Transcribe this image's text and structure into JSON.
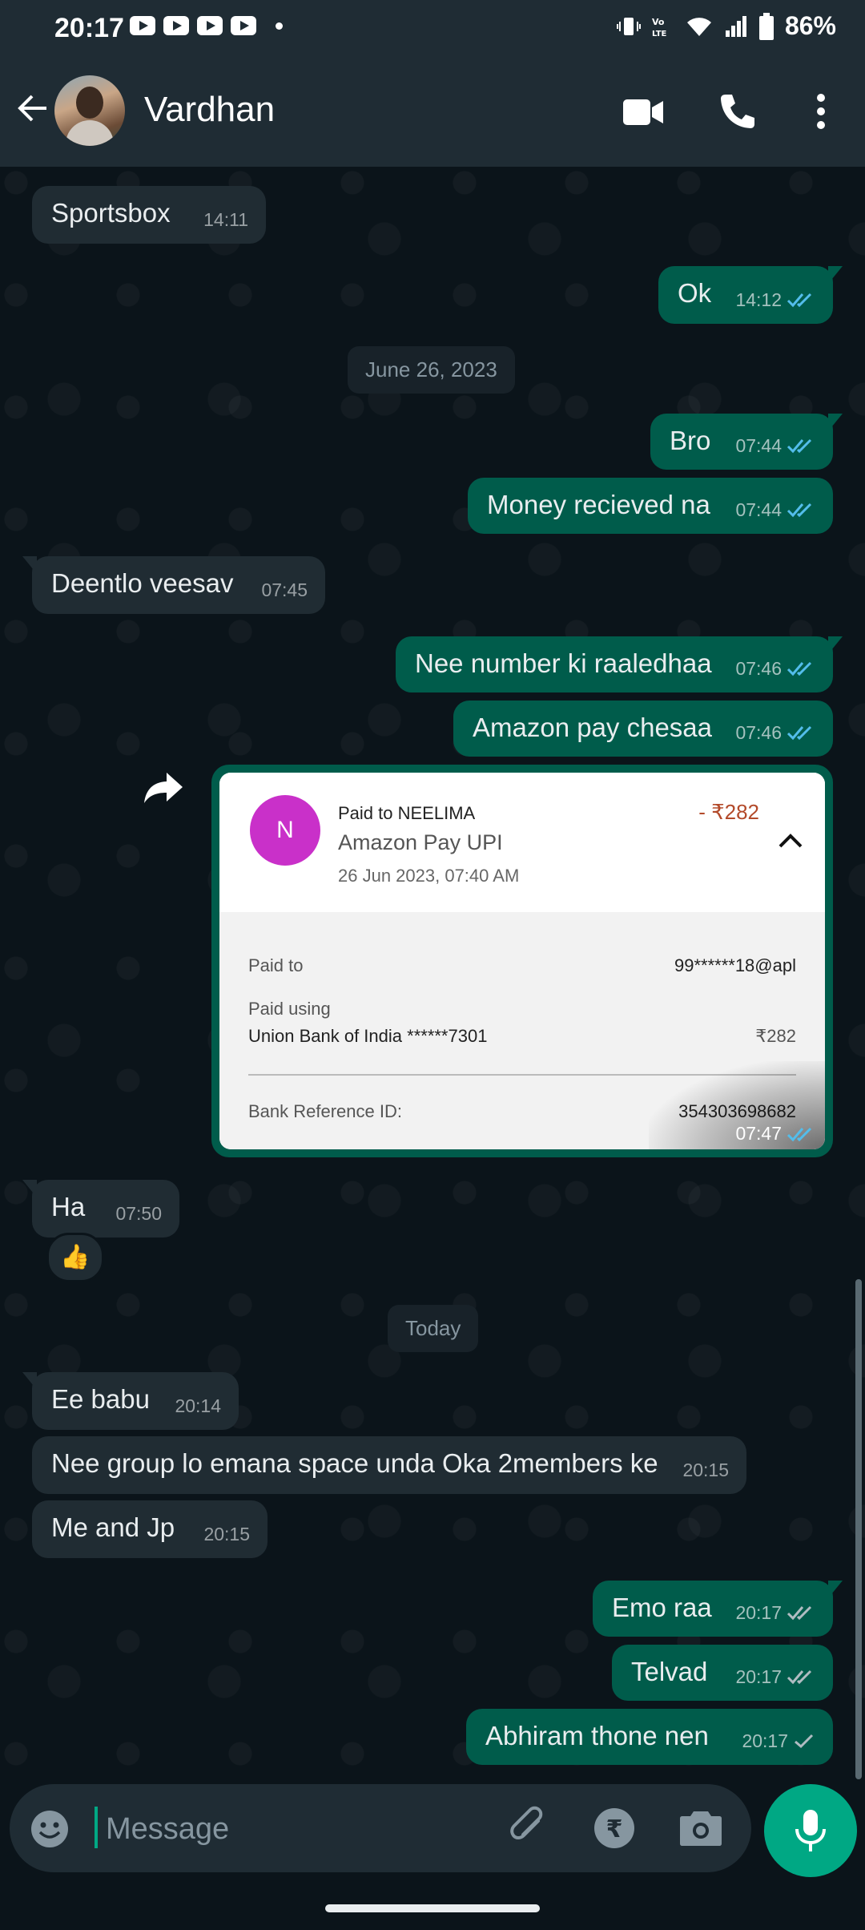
{
  "status_bar": {
    "time": "20:17",
    "battery": "86%"
  },
  "header": {
    "contact_name": "Vardhan"
  },
  "messages": [
    {
      "text": "Sportsbox",
      "time": "14:11"
    },
    {
      "text": "Ok",
      "time": "14:12"
    },
    {
      "text": "Bro",
      "time": "07:44"
    },
    {
      "text": "Money recieved na",
      "time": "07:44"
    },
    {
      "text": "Deentlo veesav",
      "time": "07:45"
    },
    {
      "text": "Nee number ki raaledhaa",
      "time": "07:46"
    },
    {
      "text": "Amazon pay chesaa",
      "time": "07:46"
    },
    {
      "text": "Ha",
      "time": "07:50"
    },
    {
      "text": "Ee babu",
      "time": "20:14"
    },
    {
      "text": "Nee group lo emana space unda Oka 2members ke",
      "time": "20:15"
    },
    {
      "text": "Me and Jp",
      "time": "20:15"
    },
    {
      "text": "Emo raa",
      "time": "20:17"
    },
    {
      "text": "Telvad",
      "time": "20:17"
    },
    {
      "text": "Abhiram thone nen",
      "time": "20:17"
    }
  ],
  "date_chips": [
    "June 26, 2023",
    "Today"
  ],
  "reaction": "👍",
  "payment_card": {
    "avatar_letter": "N",
    "paid_to_name": "Paid to NEELIMA",
    "amount": "- ₹282",
    "service": "Amazon Pay UPI",
    "date": "26 Jun 2023, 07:40 AM",
    "paid_to_label": "Paid to",
    "paid_to_value": "99******18@apl",
    "paid_using_label": "Paid using",
    "bank": "Union Bank of India ******7301",
    "bank_amount": "₹282",
    "ref_label": "Bank Reference ID:",
    "ref_value": "354303698682",
    "time": "07:47"
  },
  "input": {
    "placeholder": "Message"
  },
  "colors": {
    "incoming_bubble": "#202c33",
    "outgoing_bubble": "#005c4b",
    "accent": "#00a884",
    "read_tick": "#53bdeb"
  }
}
